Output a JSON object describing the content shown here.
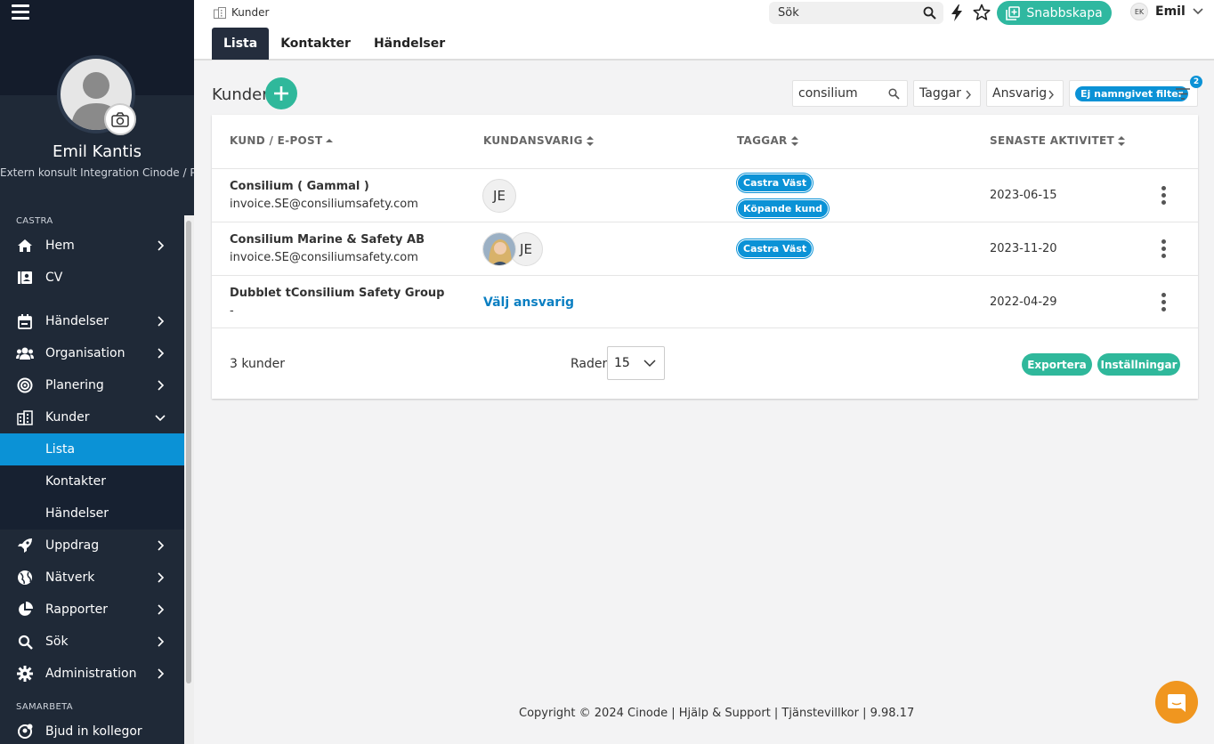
{
  "sidebar": {
    "profile_name": "Emil Kantis",
    "profile_role": "Extern konsult Integration Cinode / Pe",
    "section_castra": "CASTRA",
    "section_samarbeta": "SAMARBETA",
    "items": [
      {
        "label": "Hem",
        "icon": "home-icon"
      },
      {
        "label": "CV",
        "icon": "cv-icon"
      },
      {
        "label": "Händelser",
        "icon": "calendar-icon"
      },
      {
        "label": "Organisation",
        "icon": "people-icon"
      },
      {
        "label": "Planering",
        "icon": "target-icon"
      },
      {
        "label": "Kunder",
        "icon": "buildings-icon"
      },
      {
        "label": "Uppdrag",
        "icon": "rocket-icon"
      },
      {
        "label": "Nätverk",
        "icon": "globe-icon"
      },
      {
        "label": "Rapporter",
        "icon": "pie-icon"
      },
      {
        "label": "Sök",
        "icon": "search-icon"
      },
      {
        "label": "Administration",
        "icon": "gear-icon"
      },
      {
        "label": "Bjud in kollegor",
        "icon": "invite-icon"
      }
    ],
    "sub_items": [
      "Lista",
      "Kontakter",
      "Händelser"
    ]
  },
  "topbar": {
    "breadcrumb": "Kunder",
    "search_placeholder": "Sök",
    "quick_create": "Snabbskapa",
    "user_initials": "EK",
    "user_name": "Emil",
    "tabs": [
      "Lista",
      "Kontakter",
      "Händelser"
    ]
  },
  "main": {
    "title": "Kunder",
    "filter_search_value": "consilium",
    "filter_tags": "Taggar",
    "filter_responsible": "Ansvarig",
    "filter_chip": "Ej namngivet filter",
    "filter_count": "2",
    "columns": [
      "KUND / E-POST",
      "KUNDANSVARIG",
      "TAGGAR",
      "SENASTE AKTIVITET"
    ],
    "rows": [
      {
        "name": "Consilium ( Gammal )",
        "email": "invoice.SE@consiliumsafety.com",
        "responsible": "JE",
        "tags": [
          "Castra Väst",
          "Köpande kund"
        ],
        "date": "2023-06-15"
      },
      {
        "name": "Consilium Marine & Safety AB",
        "email": "invoice.SE@consiliumsafety.com",
        "responsible": "JE",
        "tags": [
          "Castra Väst"
        ],
        "date": "2023-11-20"
      },
      {
        "name": "Dubblet tConsilium Safety Group",
        "email": "-",
        "responsible_link": "Välj ansvarig",
        "tags": [],
        "date": "2022-04-29"
      }
    ],
    "count_text": "3 kunder",
    "rows_label": "Rader",
    "rows_value": "15",
    "export_label": "Exportera",
    "settings_label": "Inställningar"
  },
  "footer": {
    "copyright": "Copyright © 2024 Cinode | Hjälp & Support | Tjänstevillkor | 9.98.17"
  },
  "colors": {
    "sidebar_bg": "#1f2937",
    "active_blue": "#0b92d6",
    "accent_green": "#2fb89b"
  }
}
